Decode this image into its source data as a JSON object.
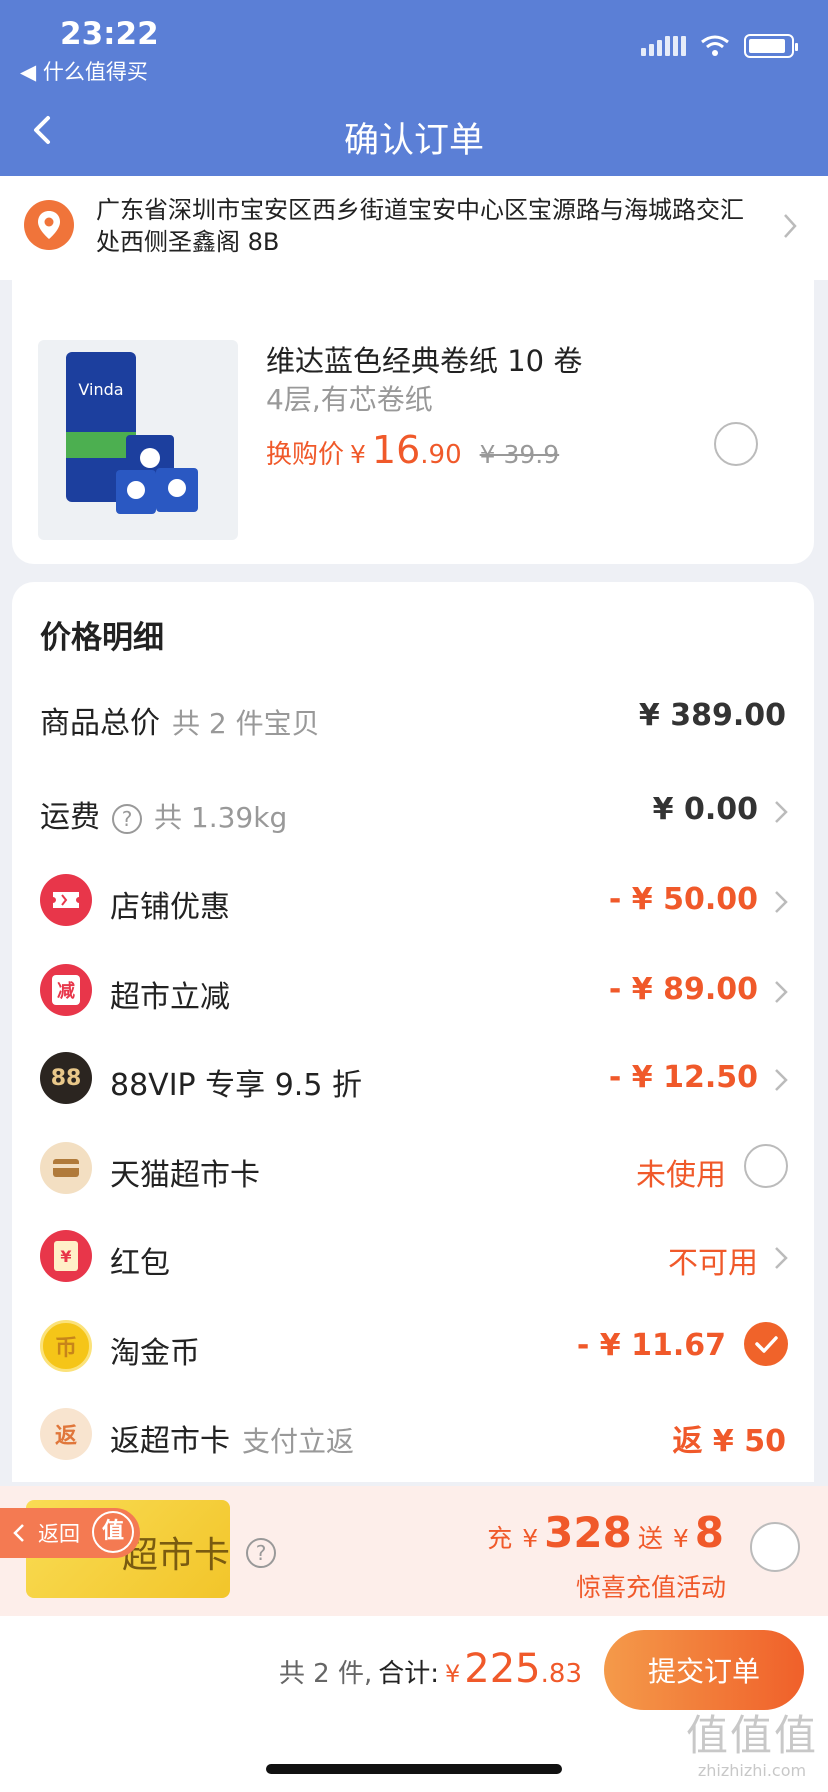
{
  "status": {
    "time": "23:22",
    "back_app": "◀ 什么值得买"
  },
  "nav": {
    "title": "确认订单"
  },
  "address": {
    "text": "广东省深圳市宝安区西乡街道宝安中心区宝源路与海城路交汇处西侧圣鑫阁 8B"
  },
  "product": {
    "name": "维达蓝色经典卷纸 10 卷",
    "spec": "4层,有芯卷纸",
    "price_label": "换购价",
    "price_yen": "¥",
    "price_int": "16",
    "price_dec": ".90",
    "original_price": "¥ 39.9"
  },
  "price_detail": {
    "title": "价格明细",
    "rows": [
      {
        "label": "商品总价",
        "sub": "共 2 件宝贝",
        "value": "¥ 389.00"
      },
      {
        "label": "运费",
        "sub": "共 1.39kg",
        "value": "¥ 0.00"
      },
      {
        "label": "店铺优惠",
        "value": "- ¥ 50.00"
      },
      {
        "label": "超市立减",
        "value": "- ¥ 89.00"
      },
      {
        "label": "88VIP 专享 9.5 折",
        "value": "- ¥ 12.50"
      },
      {
        "label": "天猫超市卡",
        "value": "未使用"
      },
      {
        "label": "红包",
        "value": "不可用"
      },
      {
        "label": "淘金币",
        "value": "- ¥ 11.67"
      },
      {
        "label": "返超市卡",
        "sub": "支付立返",
        "value": "返 ¥ 50"
      }
    ],
    "icons": {
      "shop": "减",
      "market": "减",
      "vip": "88",
      "card": "▭",
      "hongbao": "¥",
      "coin": "币",
      "rebate": "返"
    }
  },
  "promo": {
    "card_text": "超市卡",
    "float_back": "返回",
    "float_badge": "值",
    "recharge_prefix": "充",
    "recharge_yen": "¥",
    "recharge_amount": "328",
    "gift_prefix": "送",
    "gift_yen": "¥",
    "gift_amount": "8",
    "sub_text": "惊喜充值活动"
  },
  "footer": {
    "count": "共 2 件,",
    "total_label": "合计:",
    "total_yen": "¥",
    "total_int": "225",
    "total_dec": ".83",
    "submit": "提交订单"
  },
  "watermark": {
    "big": "值值值",
    "small": "zhizhizhi.com"
  },
  "colors": {
    "header": "#5b7fd6",
    "accent": "#f0592a"
  }
}
